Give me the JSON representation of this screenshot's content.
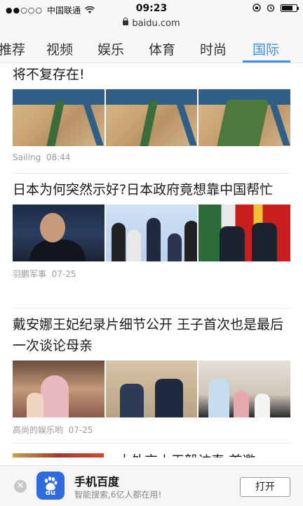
{
  "status_bar": {
    "carrier": "中国联通",
    "time": "09:23"
  },
  "url_bar": {
    "domain": "baidu.com"
  },
  "tabs": {
    "items": [
      {
        "label": "推荐"
      },
      {
        "label": "视频"
      },
      {
        "label": "娱乐"
      },
      {
        "label": "体育"
      },
      {
        "label": "时尚"
      },
      {
        "label": "国际"
      }
    ],
    "active": "国际"
  },
  "feed": {
    "articles": [
      {
        "title": "将不复存在!",
        "source": "Sailing",
        "time": "08:44"
      },
      {
        "title": "日本为何突然示好?日本政府竟想靠中国帮忙",
        "source": "羽鹏军事",
        "time": "07-25"
      },
      {
        "title": "戴安娜王妃纪录片细节公开 王子首次也是最后一次谈论母亲",
        "source": "高尚的娱乐哟",
        "time": "07-25"
      },
      {
        "title": "大外交丨王毅访泰:首邀"
      }
    ]
  },
  "banner": {
    "close_symbol": "✕",
    "app_icon_text": "du",
    "app_name": "手机百度",
    "app_subtitle": "智能搜索,6亿人都在用!",
    "open_label": "打开"
  },
  "colors": {
    "accent": "#3b8ee6",
    "text": "#1a1a1a",
    "meta": "#999999"
  }
}
